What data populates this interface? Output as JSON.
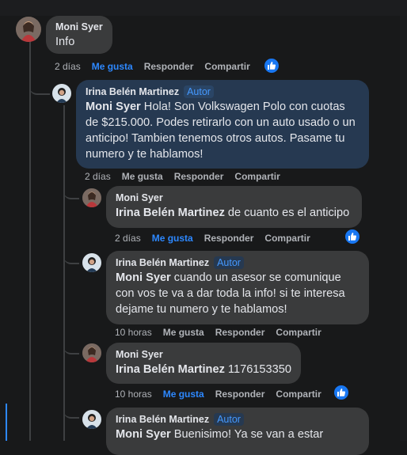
{
  "comments": [
    {
      "author": "Moni Syer",
      "badge": "",
      "mention": "",
      "text": "Info",
      "time": "2 días",
      "like_label": "Me gusta",
      "reply_label": "Responder",
      "share_label": "Compartir",
      "liked": true,
      "has_reaction": true
    },
    {
      "author": "Irina Belén Martinez",
      "badge": "Autor",
      "mention": "Moni Syer",
      "text": " Hola! Son Volkswagen Polo con cuotas de $215.000. Podes retirarlo con un auto usado o un anticipo! Tambien tenemos otros autos. Pasame tu numero y te hablamos!",
      "time": "2 días",
      "like_label": "Me gusta",
      "reply_label": "Responder",
      "share_label": "Compartir",
      "liked": false,
      "has_reaction": false
    },
    {
      "author": "Moni Syer",
      "badge": "",
      "mention": "Irina Belén Martinez",
      "text": " de cuanto es el anticipo",
      "time": "2 días",
      "like_label": "Me gusta",
      "reply_label": "Responder",
      "share_label": "Compartir",
      "liked": true,
      "has_reaction": true
    },
    {
      "author": "Irina Belén Martinez",
      "badge": "Autor",
      "mention": "Moni Syer",
      "text": " cuando un asesor se comunique con vos te va a dar toda la info! si te interesa dejame tu numero y te hablamos!",
      "time": "10 horas",
      "like_label": "Me gusta",
      "reply_label": "Responder",
      "share_label": "Compartir",
      "liked": false,
      "has_reaction": false
    },
    {
      "author": "Moni Syer",
      "badge": "",
      "mention": "Irina Belén Martinez",
      "text": " 1176153350",
      "time": "10 horas",
      "like_label": "Me gusta",
      "reply_label": "Responder",
      "share_label": "Compartir",
      "liked": true,
      "has_reaction": true
    },
    {
      "author": "Irina Belén Martinez",
      "badge": "Autor",
      "mention": "Moni Syer",
      "text": " Buenisimo! Ya se van a estar",
      "time": "",
      "like_label": "",
      "reply_label": "",
      "share_label": "",
      "liked": false,
      "has_reaction": false
    }
  ],
  "colors": {
    "background": "#18191a",
    "bubble": "#3a3b3c",
    "author_bubble": "#263951",
    "accent": "#2d88ff",
    "muted_text": "#b0b3b8"
  },
  "icons": {
    "reaction": "like-thumbs-up-icon"
  }
}
